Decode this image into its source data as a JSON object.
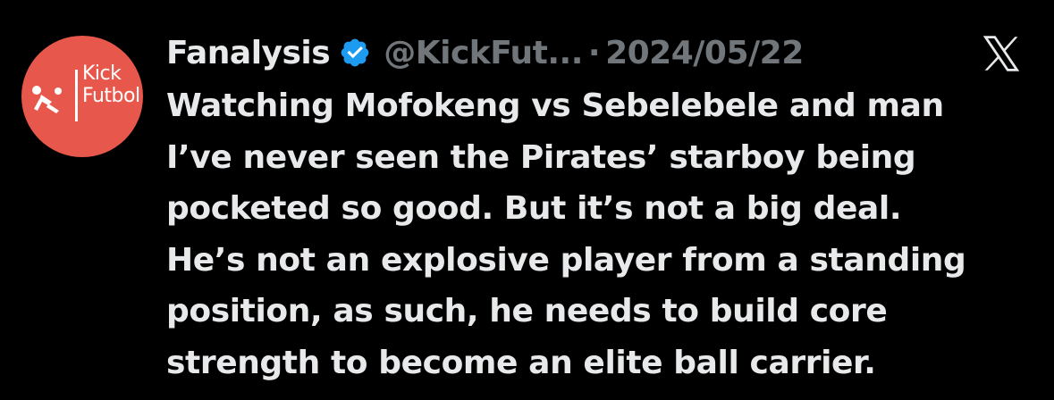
{
  "avatar": {
    "brand_line1": "Kick",
    "brand_line2": "Futbol",
    "background_color": "#e8574c",
    "icon": "footballer-icon"
  },
  "header": {
    "display_name": "Fanalysis",
    "verified_icon": "verified-badge-icon",
    "verified_color": "#1d9bf0",
    "handle": "@KickFut...",
    "separator": "·",
    "date": "2024/05/22",
    "platform_icon": "x-logo-icon"
  },
  "tweet": {
    "lines": [
      "Watching Mofokeng vs Sebelebele and man",
      "I’ve never seen the Pirates’ starboy being",
      "pocketed so good. But it’s not a big deal.",
      "He’s not an explosive player from a standing",
      "position, as such, he needs to build core",
      "strength to become an elite ball carrier."
    ]
  },
  "colors": {
    "background": "#000000",
    "primary_text": "#e7e9ea",
    "secondary_text": "#71767b"
  }
}
